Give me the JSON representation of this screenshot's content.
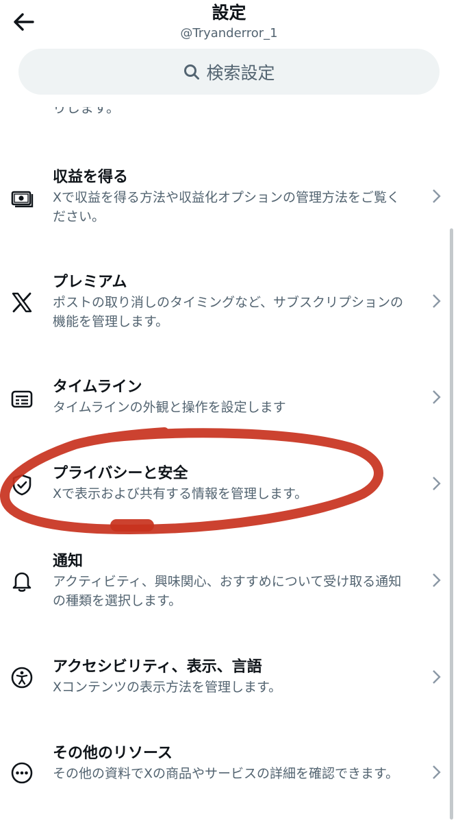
{
  "header": {
    "title": "設定",
    "username": "@Tryanderror_1",
    "search_label": "検索設定"
  },
  "partial_text": "りします。",
  "items": [
    {
      "title": "収益を得る",
      "desc": "Xで収益を得る方法や収益化オプションの管理方法をご覧ください。",
      "icon": "money-icon"
    },
    {
      "title": "プレミアム",
      "desc": "ポストの取り消しのタイミングなど、サブスクリプションの機能を管理します。",
      "icon": "x-logo-icon"
    },
    {
      "title": "タイムライン",
      "desc": "タイムラインの外観と操作を設定します",
      "icon": "timeline-icon"
    },
    {
      "title": "プライバシーと安全",
      "desc": "Xで表示および共有する情報を管理します。",
      "icon": "shield-icon"
    },
    {
      "title": "通知",
      "desc": "アクティビティ、興味関心、おすすめについて受け取る通知の種類を選択します。",
      "icon": "bell-icon"
    },
    {
      "title": "アクセシビリティ、表示、言語",
      "desc": "Xコンテンツの表示方法を管理します。",
      "icon": "accessibility-icon"
    },
    {
      "title": "その他のリソース",
      "desc": "その他の資料でXの商品やサービスの詳細を確認できます。",
      "icon": "more-icon"
    }
  ],
  "colors": {
    "text_primary": "#0f1419",
    "text_secondary": "#536471",
    "search_bg": "#eff3f4",
    "annotation": "#c8321e"
  }
}
